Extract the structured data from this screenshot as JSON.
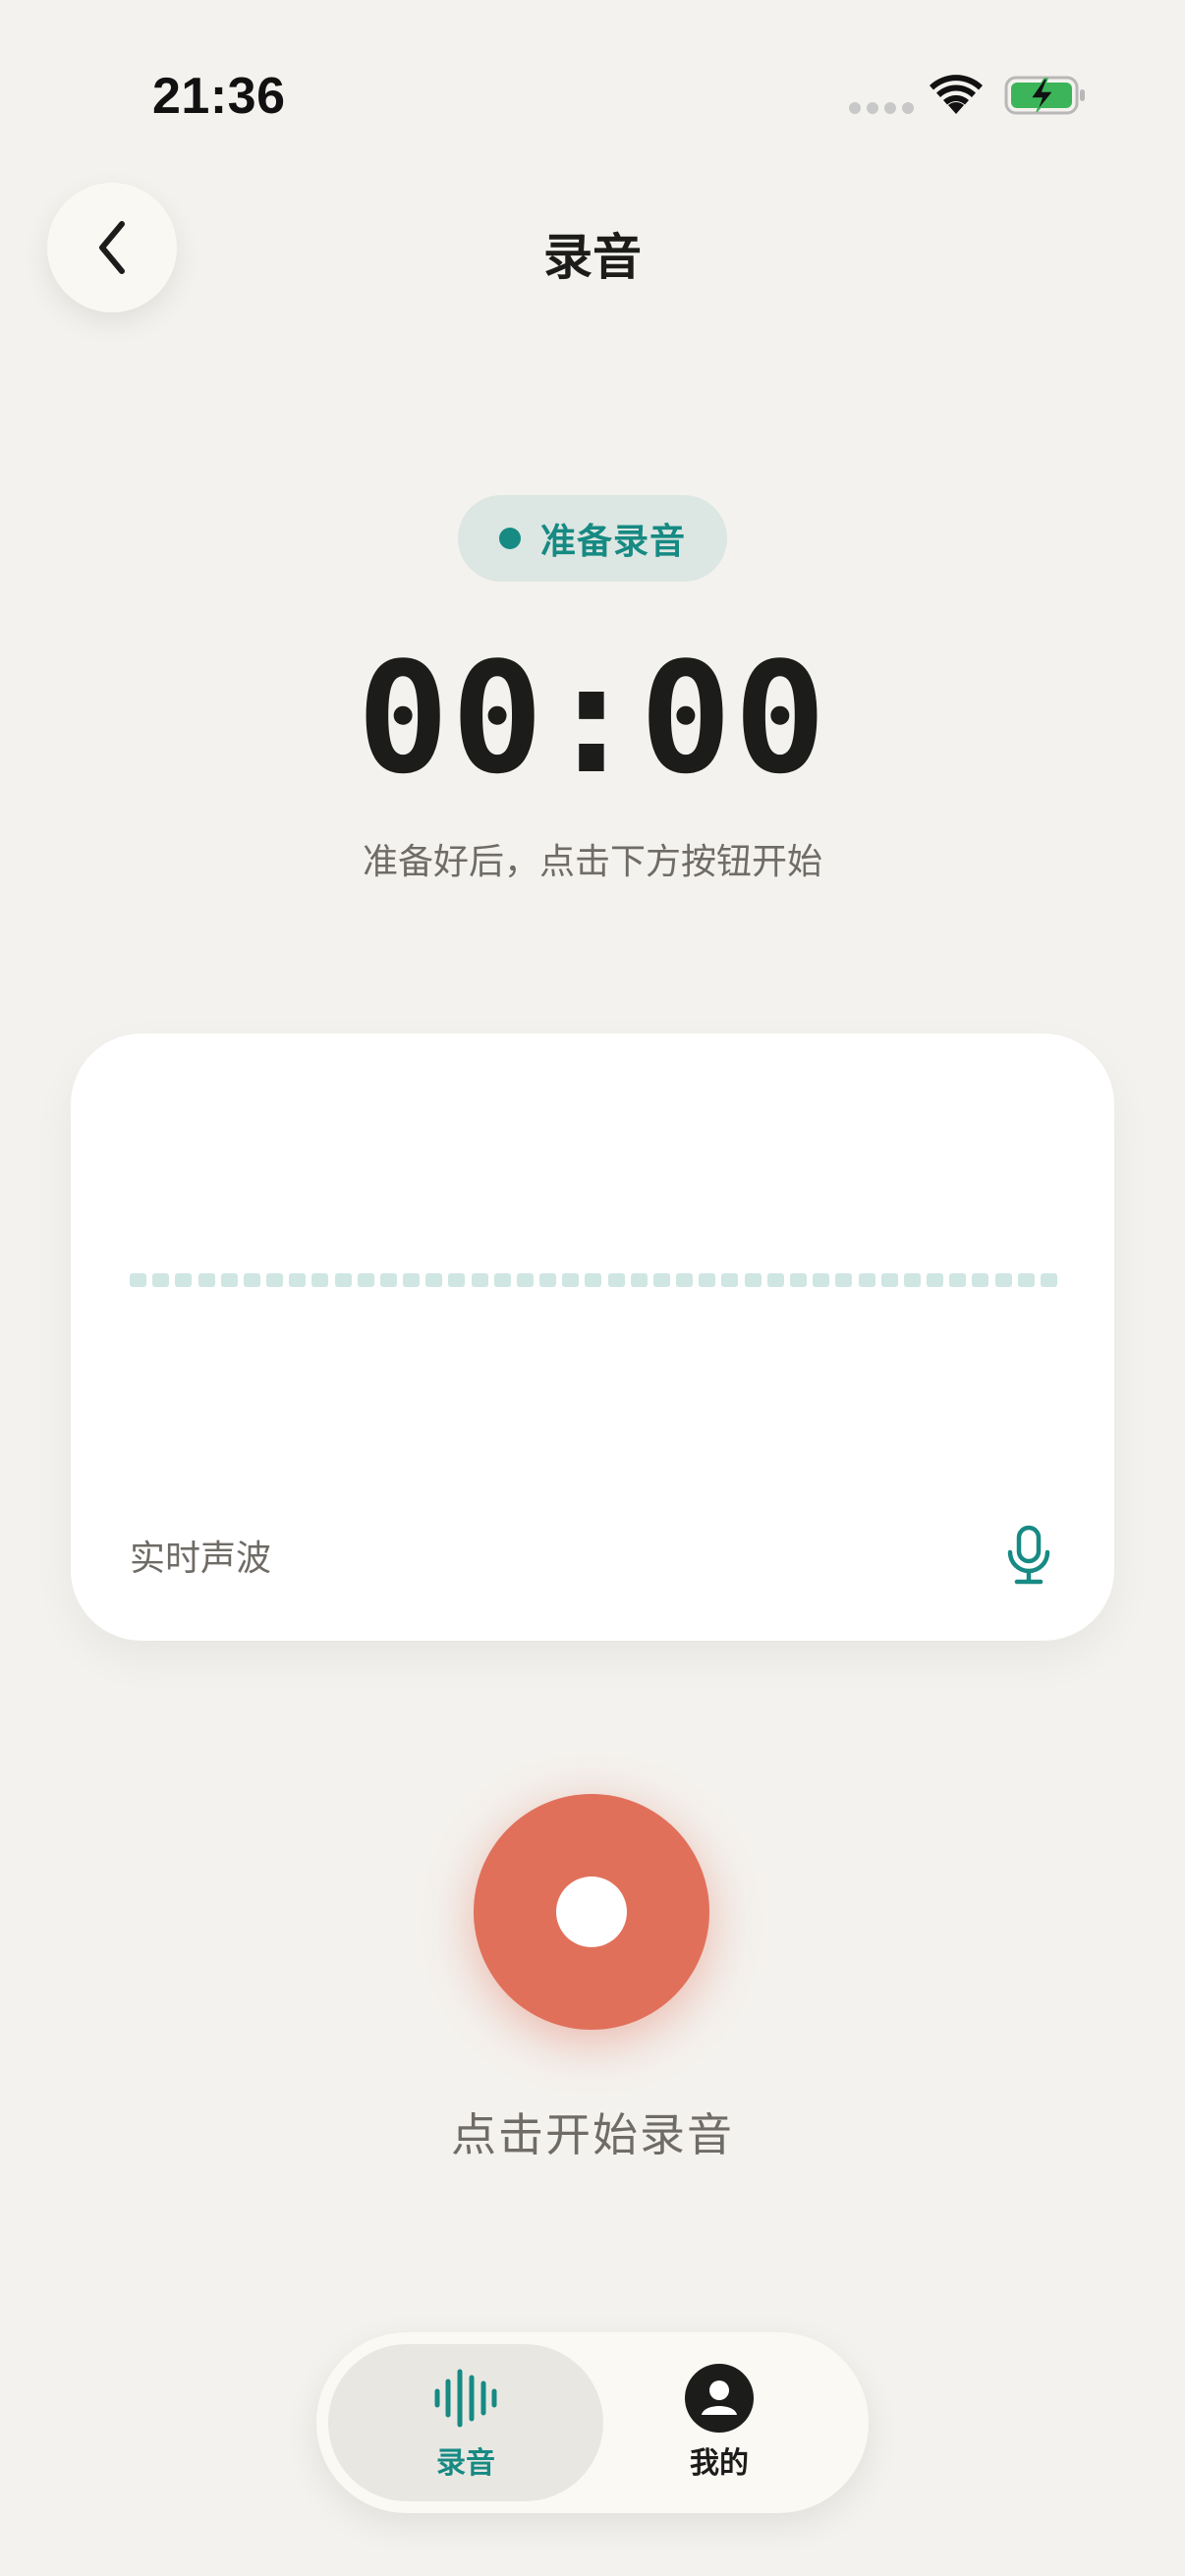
{
  "status_bar": {
    "time": "21:36",
    "wifi_icon": "wifi-icon",
    "battery_icon": "battery-charging-icon",
    "battery_color": "#3CB55A"
  },
  "header": {
    "back_icon": "chevron-left-icon",
    "title": "录音"
  },
  "recorder": {
    "status_label": "准备录音",
    "status_color": "#168A83",
    "timer": "00:00",
    "hint": "准备好后，点击下方按钮开始"
  },
  "waveform": {
    "label": "实时声波",
    "mic_icon": "microphone-icon",
    "idle_color": "#CFE6E3"
  },
  "record_button": {
    "icon": "record-dot-icon",
    "color": "#E1705B",
    "hint": "点击开始录音"
  },
  "tab_bar": {
    "tabs": [
      {
        "label": "录音",
        "icon": "waveform-icon",
        "active": true
      },
      {
        "label": "我的",
        "icon": "user-icon",
        "active": false
      }
    ],
    "accent": "#168A83"
  }
}
